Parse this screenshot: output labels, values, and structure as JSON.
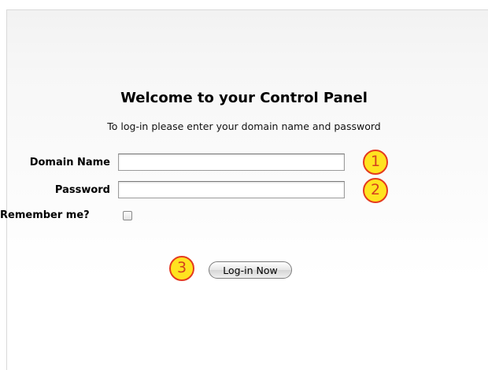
{
  "login": {
    "title": "Welcome to your Control Panel",
    "subtitle": "To log-in please enter your domain name and password",
    "domain_label": "Domain Name",
    "domain_value": "",
    "password_label": "Password",
    "password_value": "",
    "remember_label": "Remember me?",
    "remember_checked": false,
    "submit_label": "Log-in Now"
  },
  "annotations": {
    "badge_1": "1",
    "badge_2": "2",
    "badge_3": "3"
  },
  "colors": {
    "badge_fill": "#ffe320",
    "badge_border": "#e43a1f",
    "badge_text": "#d4401e"
  }
}
